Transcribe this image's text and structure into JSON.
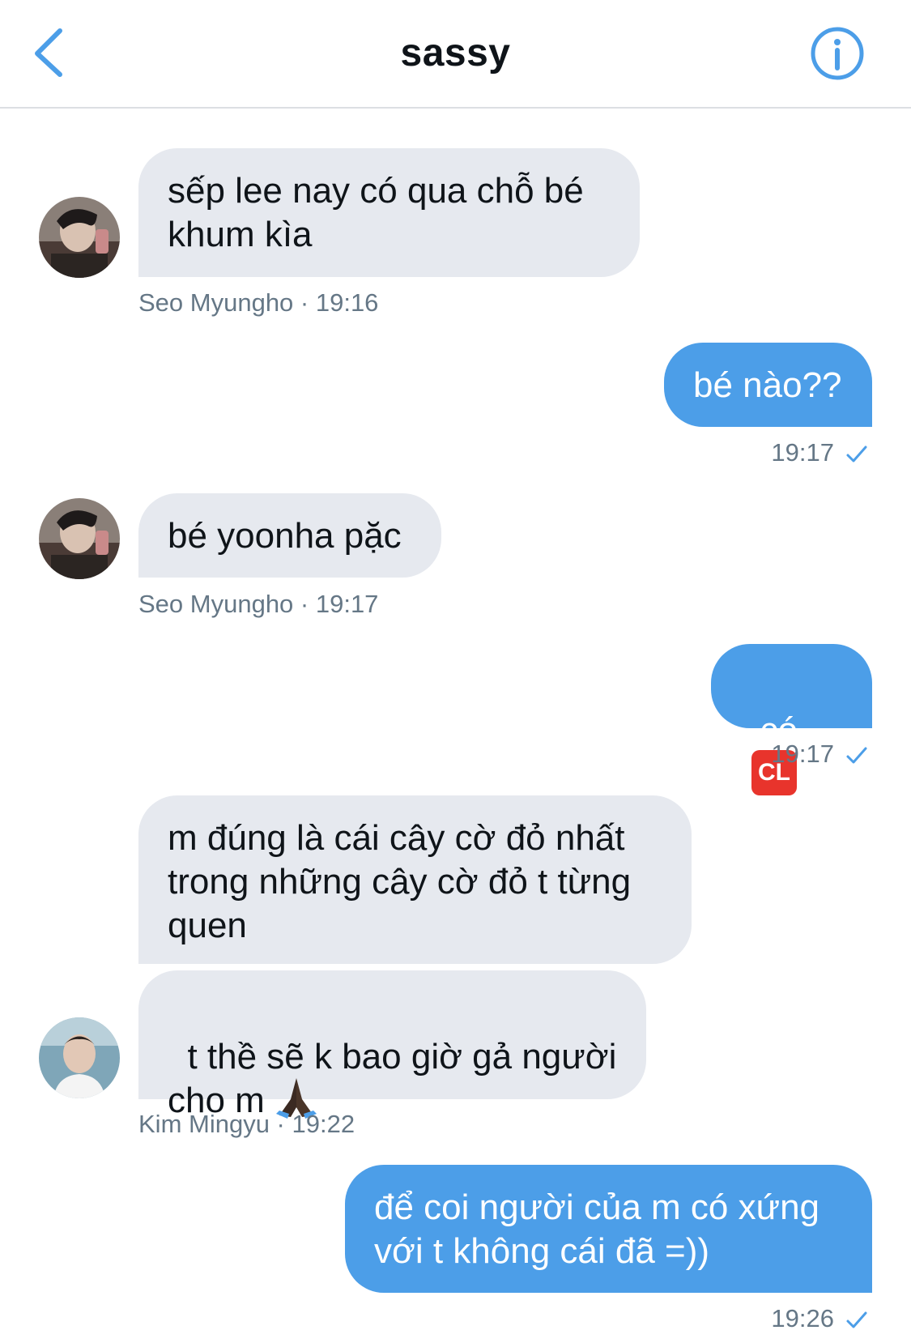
{
  "header": {
    "title": "sassy",
    "back_icon": "chevron-left-icon",
    "info_icon": "info-circle-icon",
    "accent": "#4c9ee8"
  },
  "messages": [
    {
      "dir": "in",
      "text": "sếp lee nay có qua chỗ bé\nkhum kìa",
      "sender": "Seo Myungho",
      "time": "19:16",
      "meta": "Seo Myungho · 19:16"
    },
    {
      "dir": "out",
      "text": "bé nào??",
      "time": "19:17"
    },
    {
      "dir": "in",
      "text": "bé yoonha pặc",
      "sender": "Seo Myungho",
      "time": "19:17",
      "meta": "Seo Myungho · 19:17"
    },
    {
      "dir": "out",
      "text": "có",
      "emoji": "CL",
      "time": "19:17"
    },
    {
      "dir": "in",
      "text": "m đúng là cái cây cờ đỏ nhất\ntrong những cây cờ đỏ t từng\nquen"
    },
    {
      "dir": "in",
      "text": "t thề sẽ k bao giờ gả người\ncho m",
      "emoji": "folded-hands-icon",
      "sender": "Kim Mingyu",
      "time": "19:22",
      "meta": "Kim Mingyu · 19:22"
    },
    {
      "dir": "out",
      "text": "để coi người của m có xứng\nvới t không cái đã =))",
      "time": "19:26"
    }
  ],
  "colors": {
    "incoming_bubble": "#e6e9ef",
    "outgoing_bubble": "#4c9ee8",
    "meta_text": "#657786"
  }
}
